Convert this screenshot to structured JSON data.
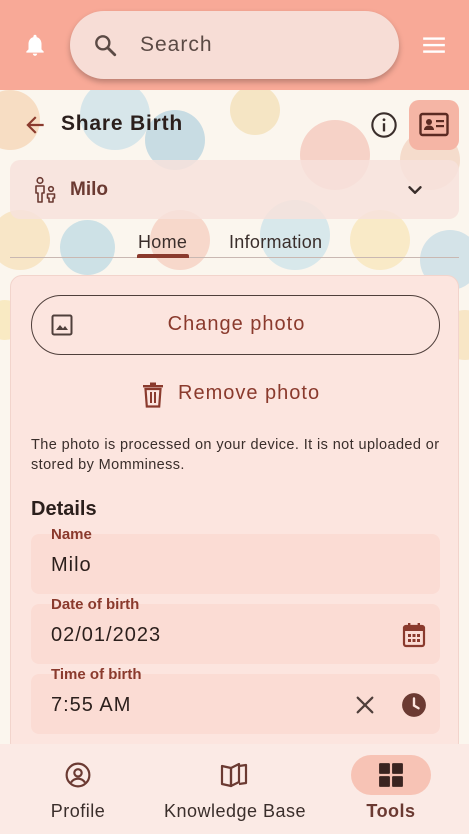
{
  "topbar": {
    "search_placeholder": "Search"
  },
  "header": {
    "title": "Share Birth"
  },
  "child_selector": {
    "selected": "Milo"
  },
  "tabs": [
    {
      "label": "Home",
      "active": true
    },
    {
      "label": "Information",
      "active": false
    }
  ],
  "photo": {
    "change_label": "Change photo",
    "remove_label": "Remove photo",
    "note": "The photo is processed on your device. It is not uploaded or stored by Momminess."
  },
  "details": {
    "title": "Details",
    "name": {
      "label": "Name",
      "value": "Milo"
    },
    "date_of_birth": {
      "label": "Date of birth",
      "value": "02/01/2023"
    },
    "time_of_birth": {
      "label": "Time of birth",
      "value": "7:55 AM"
    }
  },
  "bottom_nav": {
    "items": [
      {
        "label": "Profile",
        "icon": "profile-icon"
      },
      {
        "label": "Knowledge Base",
        "icon": "book-icon"
      },
      {
        "label": "Tools",
        "icon": "grid-icon",
        "active": true
      }
    ]
  },
  "colors": {
    "topbar": "#f8a997",
    "accent": "#8a3a2d",
    "surface": "#fce5df"
  }
}
